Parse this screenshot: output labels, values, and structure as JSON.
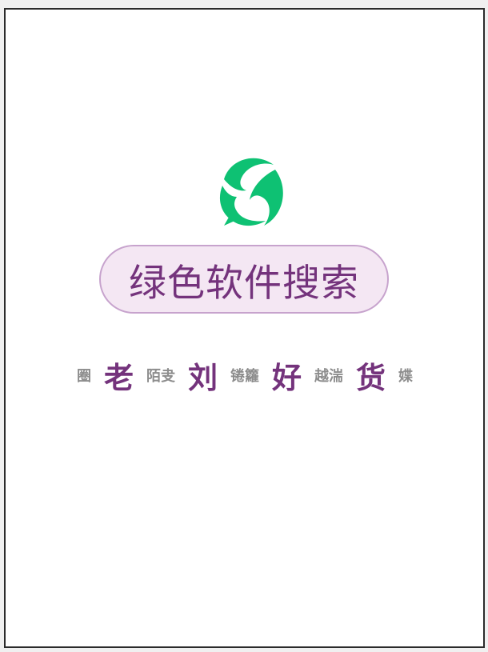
{
  "search": {
    "title": "绿色软件搜索"
  },
  "slogan": {
    "items": [
      {
        "text": "圈",
        "style": "small"
      },
      {
        "text": "老",
        "style": "big"
      },
      {
        "text": "陌叏",
        "style": "small"
      },
      {
        "text": "刘",
        "style": "big"
      },
      {
        "text": "锩籮",
        "style": "small"
      },
      {
        "text": "好",
        "style": "big"
      },
      {
        "text": "越湍",
        "style": "small"
      },
      {
        "text": "货",
        "style": "big"
      },
      {
        "text": "媟",
        "style": "small"
      }
    ]
  },
  "icons": {
    "logo": "green-swirl-chat-icon"
  },
  "colors": {
    "logo_green": "#0ec173",
    "brand_purple": "#74337c",
    "pill_background": "#f4e7f3",
    "pill_border": "#c7a3cd",
    "small_text_gray": "#8d8d8d",
    "frame_border": "#2b2b2b"
  }
}
